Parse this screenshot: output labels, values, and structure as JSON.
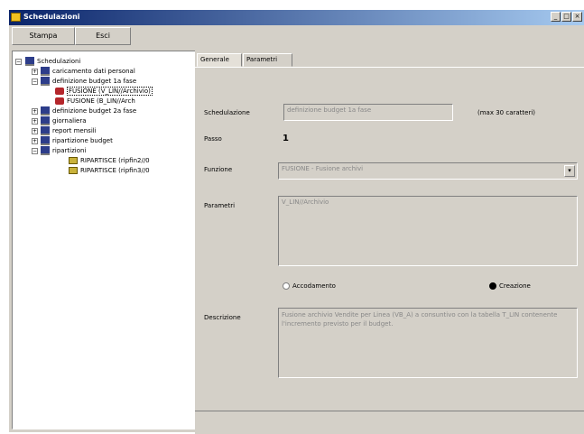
{
  "window": {
    "title": "Schedulazioni",
    "controls": {
      "minimize": "_",
      "maximize": "□",
      "close": "×"
    }
  },
  "menu": {
    "stampa": "Stampa",
    "esci": "Esci"
  },
  "tree": {
    "root": "Schedulazioni",
    "children": [
      "caricamento dati personal",
      "definizione budget 1a fase",
      "FUSIONE (V_LIN//Archivio)",
      "FUSIONE (B_LIN//Arch",
      "definizione budget 2a fase",
      "giornaliera",
      "report mensili",
      "ripartizione budget",
      "ripartizioni",
      "RIPARTISCE (ripfin2//0",
      "RIPARTISCE (ripfin3//0"
    ]
  },
  "tabs": {
    "generale": "Generale",
    "parametri": "Parametri"
  },
  "form": {
    "schedulazione_label": "Schedulazione",
    "schedulazione_value": "definizione budget 1a fase",
    "max_note": "(max 30 caratteri)",
    "passo_label": "Passo",
    "passo_value": "1",
    "funzione_label": "Funzione",
    "funzione_value": "FUSIONE - Fusione archivi",
    "parametri_label": "Parametri",
    "parametri_value": "V_LIN//Archivio",
    "radio_accodamento": "Accodamento",
    "radio_creazione": "Creazione",
    "descrizione_label": "Descrizione",
    "descrizione_value": "Fusione archivio Vendite per Linea (VB_A) a consuntivo con la tabella T_LIN contenente l'incremento previsto per il budget."
  },
  "icons": {
    "app": "app-icon",
    "folder": "folder-icon",
    "function": "function-icon",
    "grid": "grid-icon",
    "dropdown": "chevron-down-icon"
  },
  "colors": {
    "titlebar_start": "#0a246a",
    "titlebar_end": "#a6caf0",
    "face": "#d4d0c8"
  }
}
